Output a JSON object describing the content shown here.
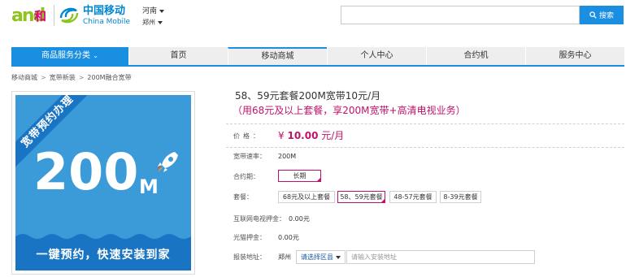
{
  "header": {
    "logo_and_text": "and",
    "logo_he_text": "和",
    "brand_cn": "中国移动",
    "brand_en": "China Mobile",
    "region": "河南",
    "city": "郑州",
    "search_placeholder": "",
    "search_button": "搜索"
  },
  "nav": {
    "items": [
      {
        "label": "商品服务分类"
      },
      {
        "label": "首页"
      },
      {
        "label": "移动商城"
      },
      {
        "label": "个人中心"
      },
      {
        "label": "合约机"
      },
      {
        "label": "服务中心"
      }
    ]
  },
  "breadcrumb": [
    "移动商城",
    "宽带新装",
    "200M融合宽带"
  ],
  "product_image": {
    "ribbon": "宽带预约办理",
    "big_number": "200",
    "unit": "M",
    "bottom_text": "一键预约，快速安装到家"
  },
  "product": {
    "title": "58、59元套餐200M宽带10元/月",
    "subtitle": "（用68元及以上套餐，享200M宽带+高清电视业务）",
    "price_label": "价格：",
    "price_symbol": "¥",
    "price_amount": "10.00",
    "price_unit": "元/月",
    "speed_label": "宽带速率：",
    "speed_value": "200M",
    "contract_label": "合约期：",
    "contract_option": "长期",
    "package_label": "套餐：",
    "package_options": [
      "68元及以上套餐",
      "58、59元套餐",
      "48-57元套餐",
      "8-39元套餐"
    ],
    "package_selected": "58、59元套餐",
    "tv_deposit_label": "互联网电视押金：",
    "tv_deposit_value": "0.00元",
    "modem_deposit_label": "光猫押金：",
    "modem_deposit_value": "0.00元",
    "address_label": "报装地址：",
    "address_city": "郑州",
    "district_select": "请选择区县",
    "address_placeholder": "请输入安装地址"
  },
  "colors": {
    "accent_blue": "#1a8ee0",
    "brand_magenta": "#c0126a",
    "image_blue": "#3b9ad8"
  }
}
